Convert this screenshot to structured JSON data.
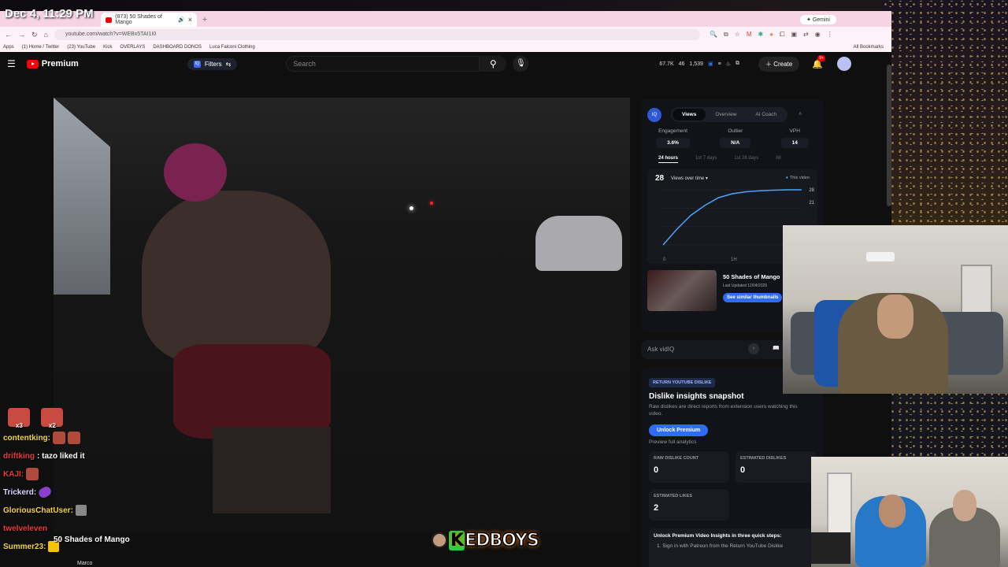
{
  "overlay": {
    "clock": "Dec 4, 11:29 PM"
  },
  "browser": {
    "tab_title": "(873) 50 Shades of Mango",
    "newtab": "+",
    "gemini": "Gemini",
    "url": "youtube.com/watch?v=WEBx5TAI1I0",
    "bookmarks": [
      "Apps",
      "(1) Home / Twitter",
      "(23) YouTube",
      "Kick",
      "OVERLAYS",
      "DASHBOARD DONOS",
      "Luca Falconi Clothing"
    ],
    "all_bookmarks": "All Bookmarks"
  },
  "youtube": {
    "logo_label": "Premium",
    "filters": "Filters",
    "search_placeholder": "Search",
    "stats": [
      "67.7K",
      "46",
      "1,539"
    ],
    "create": "Create",
    "notif_count": "9+"
  },
  "vidiq": {
    "logo": "IQ",
    "tabs": [
      "Views",
      "Overview",
      "AI Coach"
    ],
    "metrics": [
      {
        "label": "Engagement",
        "value": "3.6%"
      },
      {
        "label": "Outlier",
        "value": "N/A"
      },
      {
        "label": "VPH",
        "value": "14"
      }
    ],
    "ranges": [
      "24 hours",
      "1st 7 days",
      "1st 28 days",
      "All"
    ],
    "views_total": "28",
    "views_over_time": "Views over time ▾",
    "this_video": "This video",
    "y_labels": [
      "28",
      "21"
    ],
    "x_labels": [
      "0",
      "1H"
    ],
    "thumb_title": "50 Shades of Mango",
    "thumb_updated": "Last Updated 12/04/2025",
    "thumb_button": "See similar thumbnails",
    "ask_placeholder": "Ask vidIQ"
  },
  "chart_data": {
    "type": "line",
    "x": [
      0,
      0.1,
      0.2,
      0.3,
      0.4,
      0.5,
      0.6,
      0.7,
      0.8,
      0.9,
      1.0
    ],
    "series": [
      {
        "name": "This video",
        "values": [
          0,
          8,
          15,
          20,
          24,
          26,
          27,
          27.5,
          27.8,
          28,
          28
        ]
      }
    ],
    "ylim": [
      0,
      28
    ]
  },
  "dislike": {
    "tag": "RETURN YOUTUBE DISLIKE",
    "title": "Dislike insights snapshot",
    "desc": "Raw dislikes are direct reports from extension users watching this video.",
    "button": "Unlock Premium",
    "preview": "Preview full analytics",
    "boxes": [
      {
        "label": "RAW DISLIKE COUNT",
        "value": "0"
      },
      {
        "label": "ESTIMATED DISLIKES",
        "value": "0"
      },
      {
        "label": "ESTIMATED LIKES",
        "value": "2"
      }
    ],
    "steps_title": "Unlock Premium Video Insights in three quick steps:",
    "step1": "1.  Sign in with Patreon from the Return YouTube Dislike"
  },
  "chat": {
    "combo": [
      "x3",
      "x2"
    ],
    "lines": [
      {
        "user": "contentking:",
        "color": "#f7d43c",
        "text": ""
      },
      {
        "user": "driftking",
        "color": "#e83c3c",
        "text": ": tazo liked it"
      },
      {
        "user": "KAJI:",
        "color": "#e83c3c",
        "text": ""
      },
      {
        "user": "Trickerd:",
        "color": "#d8d8ff",
        "text": ""
      },
      {
        "user": "GloriousChatUser:",
        "color": "#f7d43c",
        "text": ""
      },
      {
        "user": "twelveleven",
        "color": "#e83c3c",
        "text": ""
      },
      {
        "user": "Summer23:",
        "color": "#f7d43c",
        "text": ""
      }
    ],
    "now_playing": "50 Shades of Mango",
    "now_playing_sub": "Marco"
  },
  "brand": {
    "first": "K",
    "rest": "EDBOYS"
  }
}
